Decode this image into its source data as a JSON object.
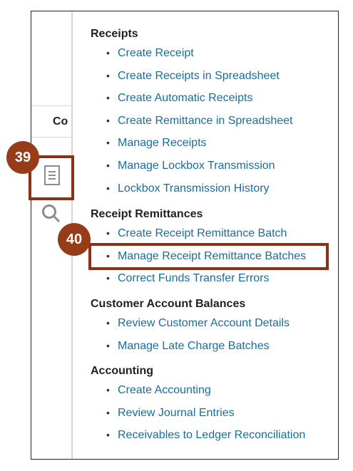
{
  "side": {
    "column_header": "Co"
  },
  "callouts": {
    "first": "39",
    "second": "40"
  },
  "colors": {
    "link": "#1a6d9a",
    "callout": "#973c18",
    "highlight_border": "#8a3217",
    "heading": "#222222"
  },
  "icons": {
    "document": "document-icon",
    "search": "search-icon"
  },
  "menu": {
    "sections": [
      {
        "title": "Receipts",
        "items": [
          "Create Receipt",
          "Create Receipts in Spreadsheet",
          "Create Automatic Receipts",
          "Create Remittance in Spreadsheet",
          "Manage Receipts",
          "Manage Lockbox Transmission",
          "Lockbox Transmission History"
        ]
      },
      {
        "title": "Receipt Remittances",
        "items": [
          "Create Receipt Remittance Batch",
          "Manage Receipt Remittance Batches",
          "Correct Funds Transfer Errors"
        ]
      },
      {
        "title": "Customer Account Balances",
        "items": [
          "Review Customer Account Details",
          "Manage Late Charge Batches"
        ]
      },
      {
        "title": "Accounting",
        "items": [
          "Create Accounting",
          "Review Journal Entries",
          "Receivables to Ledger Reconciliation"
        ]
      }
    ]
  }
}
